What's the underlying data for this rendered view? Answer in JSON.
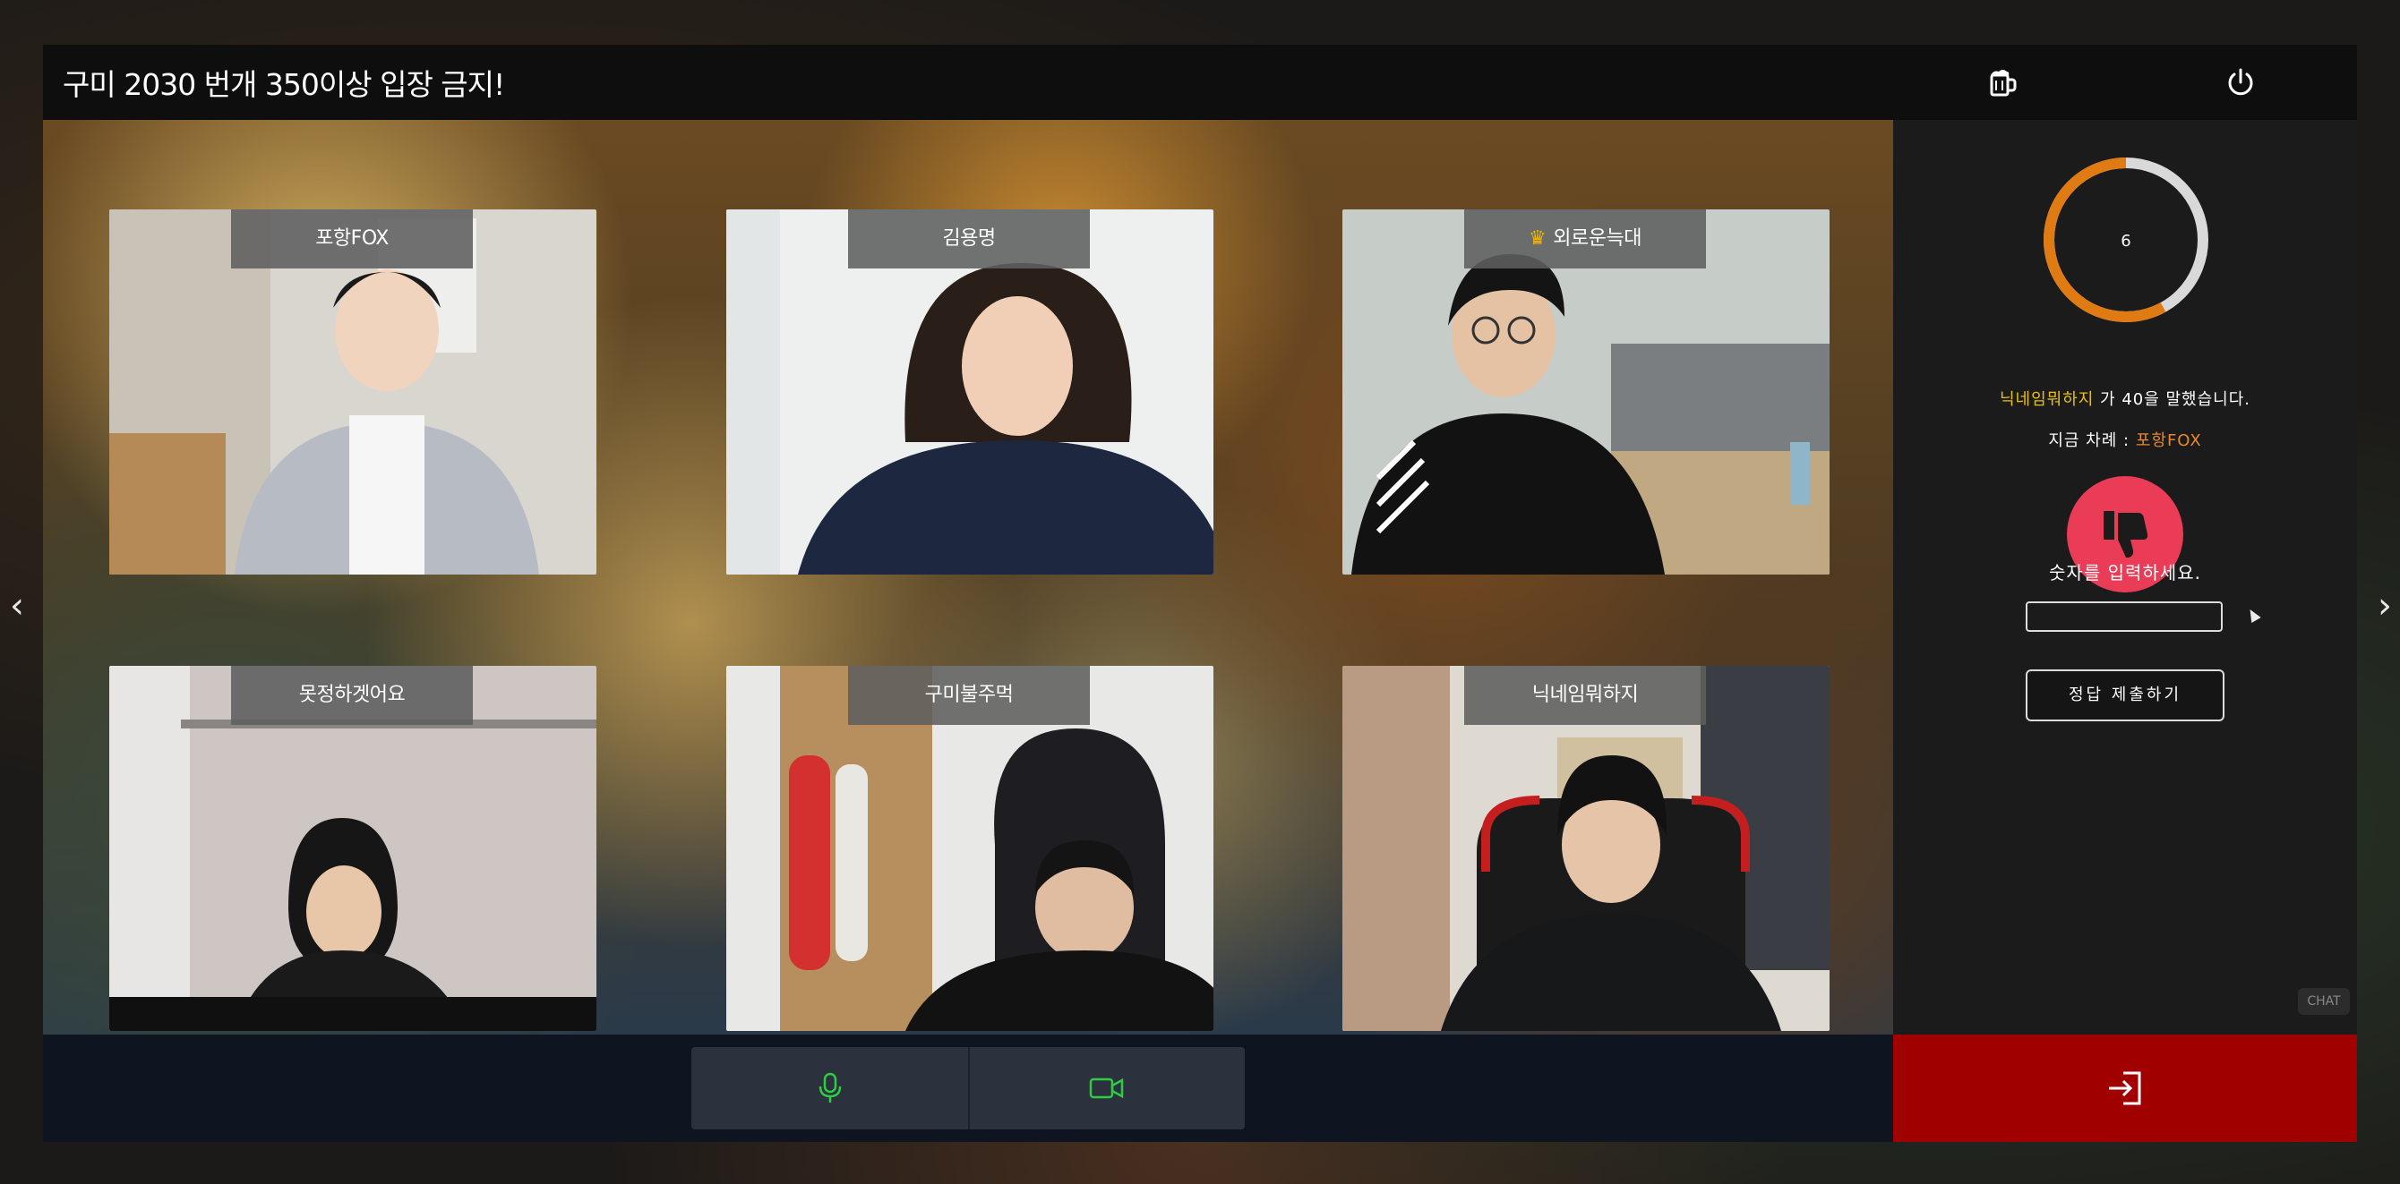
{
  "room": {
    "title": "구미 2030 번개 350이상 입장 금지!"
  },
  "topbar": {
    "beer_icon": "beer-mug-icon",
    "power_icon": "power-icon"
  },
  "participants": [
    {
      "name": "포항FOX",
      "host": false
    },
    {
      "name": "김용명",
      "host": false
    },
    {
      "name": "외로운늑대",
      "host": true
    },
    {
      "name": "못정하겟어요",
      "host": false
    },
    {
      "name": "구미불주먹",
      "host": false
    },
    {
      "name": "닉네임뭐하지",
      "host": false
    }
  ],
  "game": {
    "timer": "6",
    "timer_progress": 0.58,
    "last_speaker": "닉네임뭐하지",
    "said_text": " 가 40을 말했습니다.",
    "turn_label": "지금 차례 : ",
    "turn_name": "포항FOX",
    "thumb_icon": "thumbs-down-icon",
    "input_prompt": "숫자를 입력하세요.",
    "answer_value": "",
    "submit_label": "정답 제출하기"
  },
  "controls": {
    "mic_icon": "microphone-icon",
    "camera_icon": "video-camera-icon",
    "exit_icon": "exit-door-icon",
    "accent_green": "#2ecc40",
    "exit_color": "#a00000"
  },
  "chat_badge": "CHAT",
  "nav": {
    "left_icon": "chevron-left-icon",
    "right_icon": "chevron-right-icon"
  }
}
